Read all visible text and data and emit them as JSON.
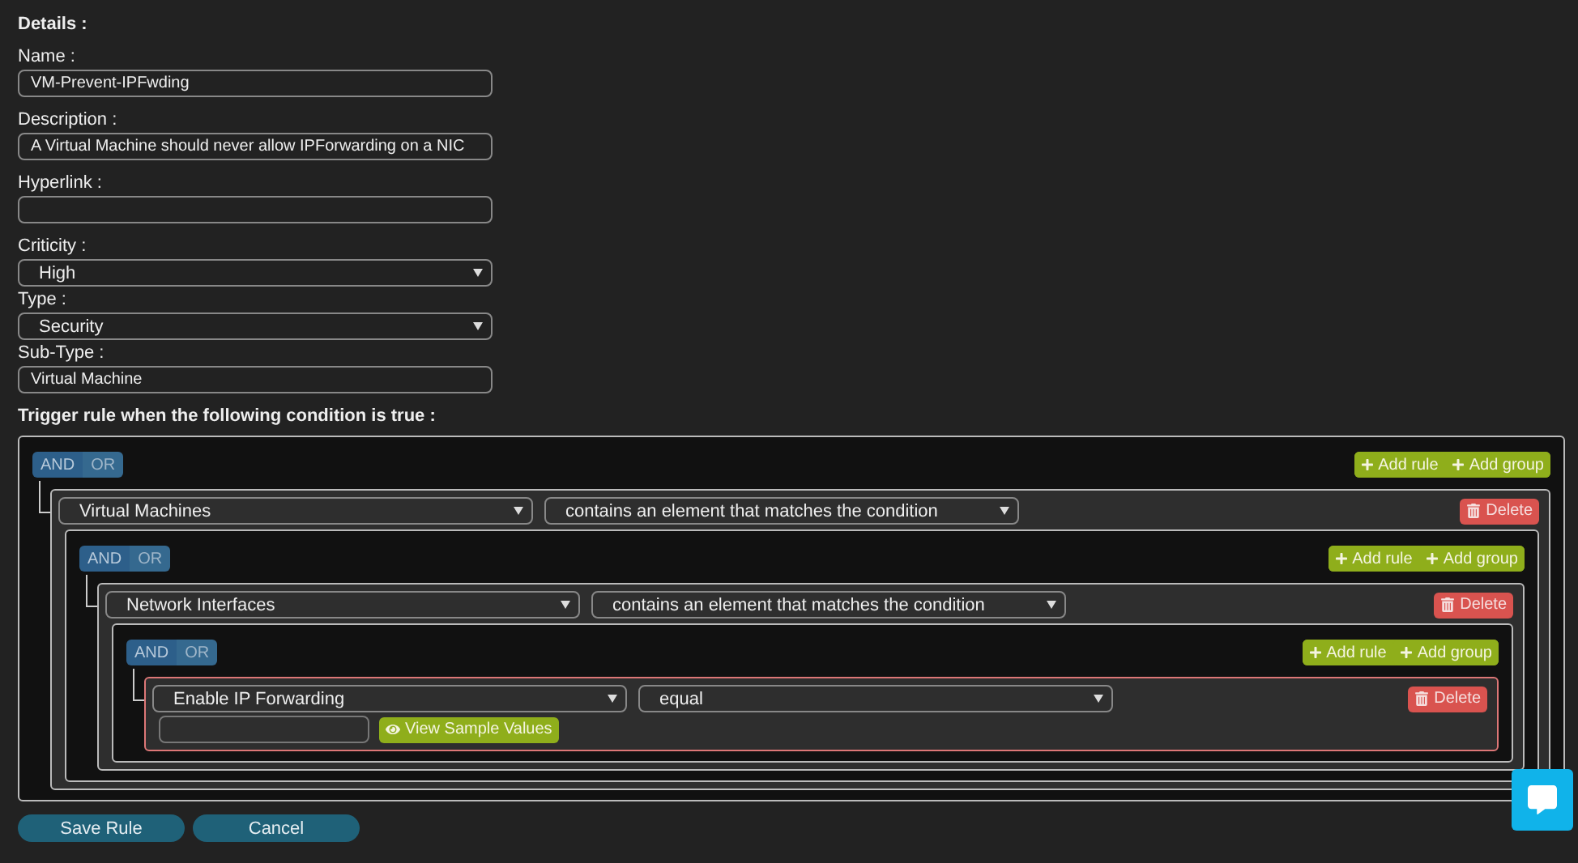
{
  "heading": "Details :",
  "fields": [
    {
      "kind": "text",
      "label": "Name :",
      "value": "VM-Prevent-IPFwding"
    },
    {
      "kind": "text",
      "label": "Description :",
      "value": "A Virtual Machine should never allow IPForwarding on a NIC"
    },
    {
      "kind": "text",
      "label": "Hyperlink :"
    },
    {
      "kind": "select",
      "label": "Criticity :",
      "value": "High"
    },
    {
      "kind": "select",
      "label": "Type :",
      "value": "Security"
    },
    {
      "kind": "text",
      "label": "Sub-Type :",
      "value": "Virtual Machine"
    }
  ],
  "trigger_label": "Trigger rule when the following condition is true :",
  "condition": {
    "conjunctions": [
      {
        "label": "AND",
        "selected": true
      },
      {
        "label": "OR",
        "selected": false
      }
    ],
    "actions": [
      "Add rule",
      "Add group"
    ],
    "rules": [
      {
        "kind": "nested",
        "field": "Virtual Machines",
        "operator": "contains an element that matches the condition",
        "delete": "Delete",
        "invalid": false,
        "group": {
          "conjunctions": [
            {
              "label": "AND",
              "selected": true
            },
            {
              "label": "OR",
              "selected": false
            }
          ],
          "actions": [
            "Add rule",
            "Add group"
          ],
          "rules": [
            {
              "kind": "nested",
              "field": "Network Interfaces",
              "operator": "contains an element that matches the condition",
              "delete": "Delete",
              "invalid": false,
              "group": {
                "conjunctions": [
                  {
                    "label": "AND",
                    "selected": true
                  },
                  {
                    "label": "OR",
                    "selected": false
                  }
                ],
                "actions": [
                  "Add rule",
                  "Add group"
                ],
                "rules": [
                  {
                    "kind": "value",
                    "field": "Enable IP Forwarding",
                    "operator": "equal",
                    "delete": "Delete",
                    "invalid": true,
                    "sample_button": "View Sample Values"
                  }
                ]
              }
            }
          ]
        }
      }
    ]
  },
  "buttons": [
    "Save Rule",
    "Cancel"
  ]
}
